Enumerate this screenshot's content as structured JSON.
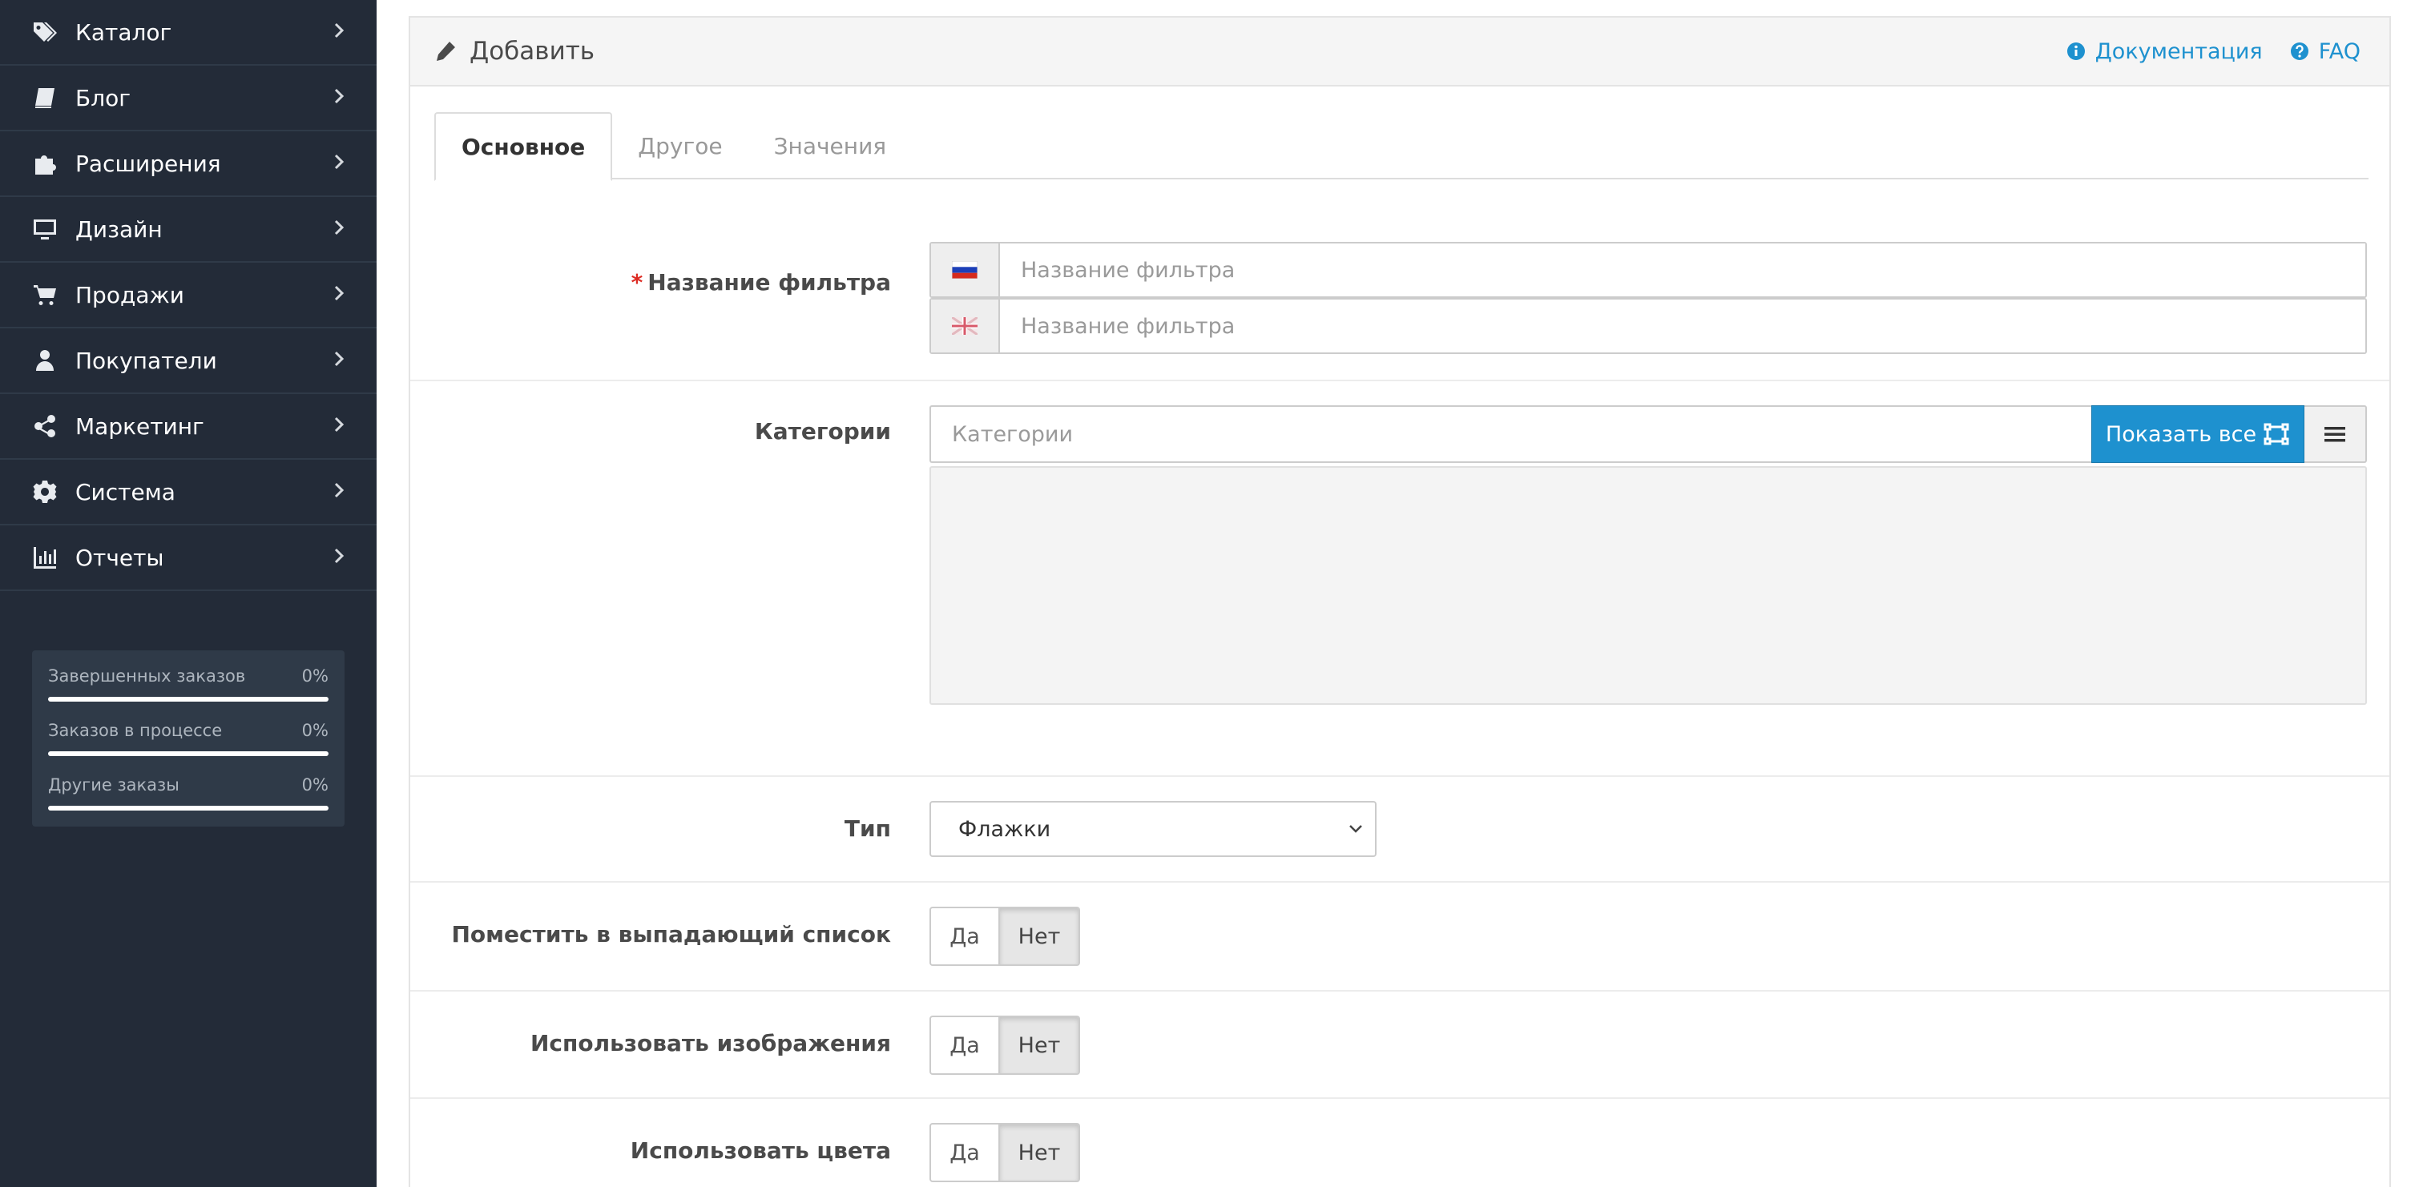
{
  "sidebar": {
    "menu": [
      {
        "label": "Каталог",
        "icon": "tags-icon"
      },
      {
        "label": "Блог",
        "icon": "book-icon"
      },
      {
        "label": "Расширения",
        "icon": "puzzle-icon"
      },
      {
        "label": "Дизайн",
        "icon": "monitor-icon"
      },
      {
        "label": "Продажи",
        "icon": "cart-icon"
      },
      {
        "label": "Покупатели",
        "icon": "user-icon"
      },
      {
        "label": "Маркетинг",
        "icon": "share-icon"
      },
      {
        "label": "Система",
        "icon": "gear-icon"
      },
      {
        "label": "Отчеты",
        "icon": "bar-chart-icon"
      }
    ],
    "stats": [
      {
        "label": "Завершенных заказов",
        "value": "0%",
        "progress": 0
      },
      {
        "label": "Заказов в процессе",
        "value": "0%",
        "progress": 0
      },
      {
        "label": "Другие заказы",
        "value": "0%",
        "progress": 0
      }
    ]
  },
  "header": {
    "title": "Добавить",
    "docs_link": "Документация",
    "faq_link": "FAQ"
  },
  "tabs": [
    {
      "label": "Основное",
      "active": true
    },
    {
      "label": "Другое",
      "active": false
    },
    {
      "label": "Значения",
      "active": false
    }
  ],
  "form": {
    "filter_name": {
      "label": "Название фильтра",
      "required_mark": "*",
      "inputs": [
        {
          "language": "ru",
          "placeholder": "Название фильтра",
          "value": ""
        },
        {
          "language": "en-gb",
          "placeholder": "Название фильтра",
          "value": ""
        }
      ]
    },
    "categories": {
      "label": "Категории",
      "placeholder": "Категории",
      "show_all_label": "Показать все"
    },
    "type": {
      "label": "Тип",
      "selected": "Флажки"
    },
    "dropdown_list": {
      "label": "Поместить в выпадающий список",
      "yes": "Да",
      "no": "Нет",
      "selected": "Нет"
    },
    "use_images": {
      "label": "Использовать изображения",
      "yes": "Да",
      "no": "Нет",
      "selected": "Нет"
    },
    "use_colors": {
      "label": "Использовать цвета",
      "yes": "Да",
      "no": "Нет",
      "selected": "Нет"
    }
  },
  "colors": {
    "sidebar_bg": "#232b38",
    "accent": "#1e91cf",
    "required": "#dd2c24"
  }
}
